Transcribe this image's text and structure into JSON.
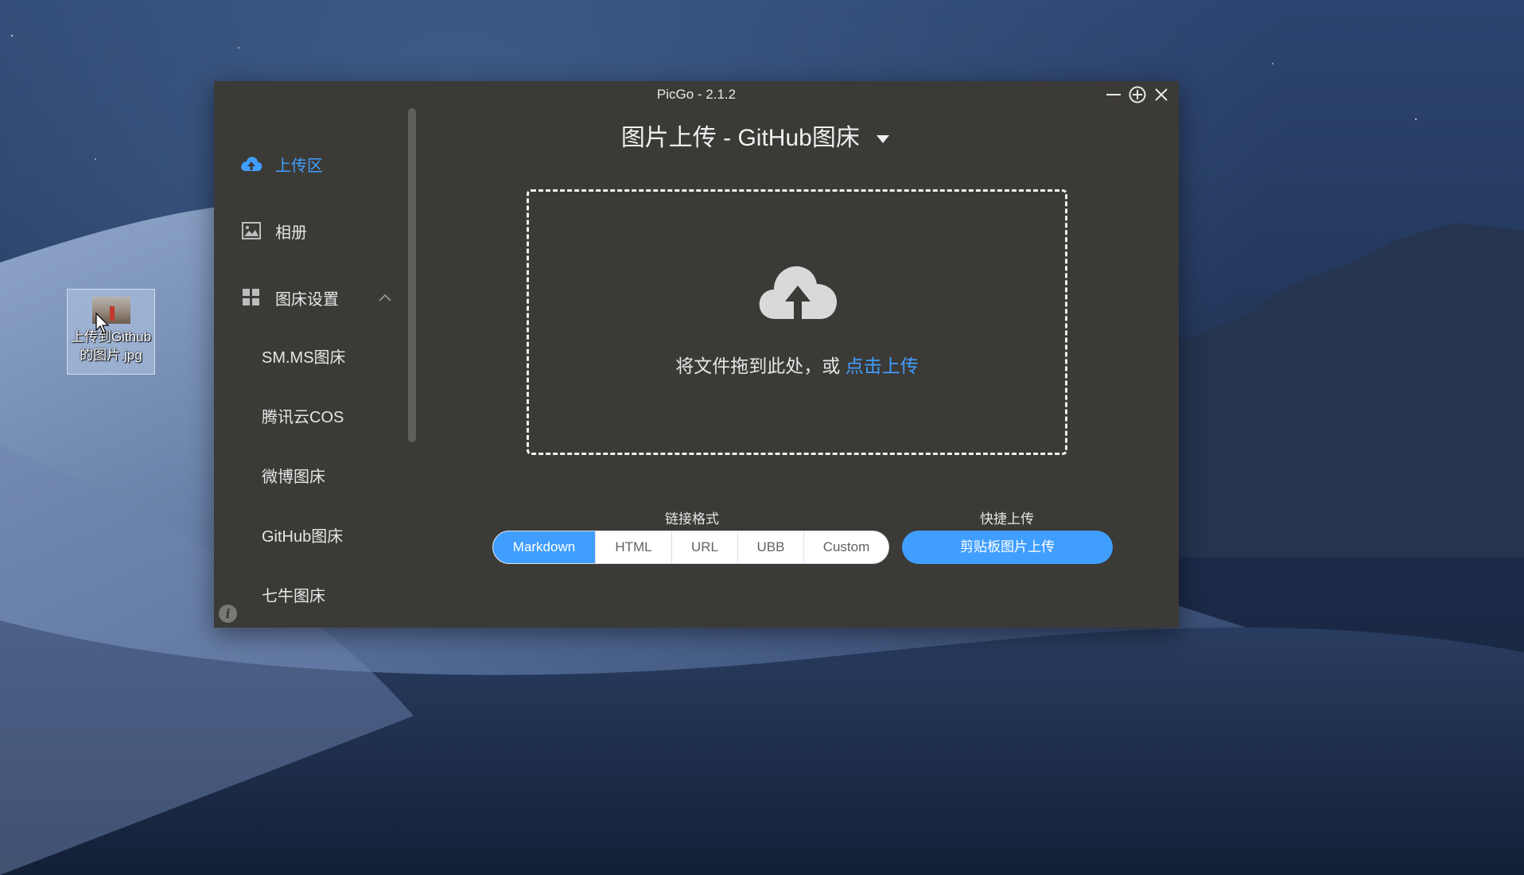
{
  "window": {
    "title": "PicGo - 2.1.2"
  },
  "desktop": {
    "file_label": "上传到Github的图片.jpg"
  },
  "sidebar": {
    "items": [
      {
        "label": "上传区",
        "icon": "cloud-upload-icon",
        "active": true
      },
      {
        "label": "相册",
        "icon": "image-icon",
        "active": false
      },
      {
        "label": "图床设置",
        "icon": "grid-icon",
        "active": false
      }
    ],
    "sub_items": [
      "SM.MS图床",
      "腾讯云COS",
      "微博图床",
      "GitHub图床",
      "七牛图床"
    ]
  },
  "main": {
    "title": "图片上传 - GitHub图床",
    "drop_text": "将文件拖到此处，或 ",
    "drop_link": "点击上传",
    "link_format_label": "链接格式",
    "link_formats": [
      "Markdown",
      "HTML",
      "URL",
      "UBB",
      "Custom"
    ],
    "selected_format": "Markdown",
    "quick_upload_label": "快捷上传",
    "quick_upload_button": "剪贴板图片上传"
  },
  "colors": {
    "accent": "#409eff",
    "window_bg": "#3c3a37"
  }
}
